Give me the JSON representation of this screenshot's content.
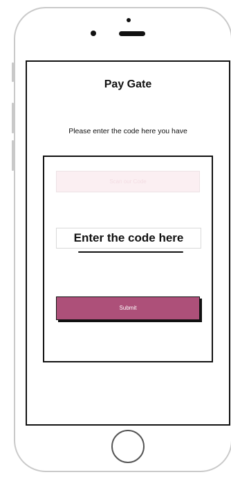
{
  "app": {
    "title": "Pay Gate",
    "prompt": "Please enter the code here you have"
  },
  "form": {
    "scan_button_label": "Scan our Code",
    "code_field_value": "Enter the code here",
    "submit_label": "Submit"
  },
  "colors": {
    "accent": "#ad5079",
    "scan_button_bg": "#fbeff2",
    "frame": "#c9c9c9"
  },
  "icons": {
    "camera": "camera-icon",
    "speaker": "speaker-icon",
    "home": "home-button-icon"
  }
}
